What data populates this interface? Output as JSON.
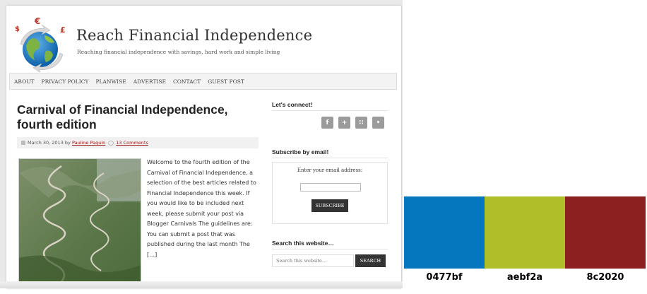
{
  "site": {
    "title": "Reach Financial Independence",
    "description": "Reaching financial independence with savings, hard work and simple living",
    "currency_symbols": [
      "$",
      "€",
      "£"
    ]
  },
  "nav": {
    "items": [
      {
        "label": "ABOUT"
      },
      {
        "label": "PRIVACY POLICY"
      },
      {
        "label": "PLANWISE"
      },
      {
        "label": "ADVERTISE"
      },
      {
        "label": "CONTACT"
      },
      {
        "label": "GUEST POST"
      }
    ]
  },
  "post": {
    "title": "Carnival of Financial Independence, fourth edition",
    "date": "March 30, 2013",
    "by": "by",
    "author": "Pauline Paquin",
    "comments": "13 Comments",
    "excerpt": "Welcome to the fourth edition of the Carnival of Financial Independence, a selection of the best articles related to Financial Independence this week. If you would like to be included next week, please submit your post via Blogger Carnivals The guidelines are: You can submit a post that was published during the last month The […]"
  },
  "sidebar": {
    "connect_heading": "Let's connect!",
    "social": [
      {
        "icon": "facebook-icon",
        "glyph": "f"
      },
      {
        "icon": "google-plus-icon",
        "glyph": "+"
      },
      {
        "icon": "rss-icon",
        "glyph": "∷"
      },
      {
        "icon": "twitter-icon",
        "glyph": "•"
      }
    ],
    "subscribe_heading": "Subscribe by email!",
    "email_label": "Enter your email address:",
    "email_value": "",
    "subscribe_button": "SUBSCRIBE",
    "search_heading": "Search this website…",
    "search_placeholder": "Search this website…",
    "search_button": "SEARCH"
  },
  "palette": [
    {
      "hex": "#0477bf",
      "label": "0477bf"
    },
    {
      "hex": "#aebf2a",
      "label": "aebf2a"
    },
    {
      "hex": "#8c2020",
      "label": "8c2020"
    }
  ]
}
